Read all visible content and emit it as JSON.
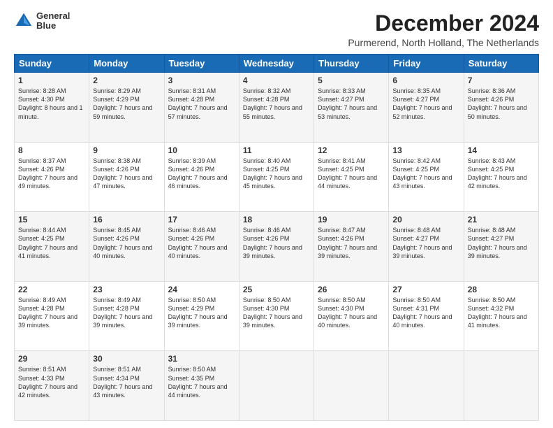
{
  "logo": {
    "line1": "General",
    "line2": "Blue"
  },
  "title": "December 2024",
  "subtitle": "Purmerend, North Holland, The Netherlands",
  "headers": [
    "Sunday",
    "Monday",
    "Tuesday",
    "Wednesday",
    "Thursday",
    "Friday",
    "Saturday"
  ],
  "weeks": [
    [
      {
        "day": "1",
        "sunrise": "Sunrise: 8:28 AM",
        "sunset": "Sunset: 4:30 PM",
        "daylight": "Daylight: 8 hours and 1 minute."
      },
      {
        "day": "2",
        "sunrise": "Sunrise: 8:29 AM",
        "sunset": "Sunset: 4:29 PM",
        "daylight": "Daylight: 7 hours and 59 minutes."
      },
      {
        "day": "3",
        "sunrise": "Sunrise: 8:31 AM",
        "sunset": "Sunset: 4:28 PM",
        "daylight": "Daylight: 7 hours and 57 minutes."
      },
      {
        "day": "4",
        "sunrise": "Sunrise: 8:32 AM",
        "sunset": "Sunset: 4:28 PM",
        "daylight": "Daylight: 7 hours and 55 minutes."
      },
      {
        "day": "5",
        "sunrise": "Sunrise: 8:33 AM",
        "sunset": "Sunset: 4:27 PM",
        "daylight": "Daylight: 7 hours and 53 minutes."
      },
      {
        "day": "6",
        "sunrise": "Sunrise: 8:35 AM",
        "sunset": "Sunset: 4:27 PM",
        "daylight": "Daylight: 7 hours and 52 minutes."
      },
      {
        "day": "7",
        "sunrise": "Sunrise: 8:36 AM",
        "sunset": "Sunset: 4:26 PM",
        "daylight": "Daylight: 7 hours and 50 minutes."
      }
    ],
    [
      {
        "day": "8",
        "sunrise": "Sunrise: 8:37 AM",
        "sunset": "Sunset: 4:26 PM",
        "daylight": "Daylight: 7 hours and 49 minutes."
      },
      {
        "day": "9",
        "sunrise": "Sunrise: 8:38 AM",
        "sunset": "Sunset: 4:26 PM",
        "daylight": "Daylight: 7 hours and 47 minutes."
      },
      {
        "day": "10",
        "sunrise": "Sunrise: 8:39 AM",
        "sunset": "Sunset: 4:26 PM",
        "daylight": "Daylight: 7 hours and 46 minutes."
      },
      {
        "day": "11",
        "sunrise": "Sunrise: 8:40 AM",
        "sunset": "Sunset: 4:25 PM",
        "daylight": "Daylight: 7 hours and 45 minutes."
      },
      {
        "day": "12",
        "sunrise": "Sunrise: 8:41 AM",
        "sunset": "Sunset: 4:25 PM",
        "daylight": "Daylight: 7 hours and 44 minutes."
      },
      {
        "day": "13",
        "sunrise": "Sunrise: 8:42 AM",
        "sunset": "Sunset: 4:25 PM",
        "daylight": "Daylight: 7 hours and 43 minutes."
      },
      {
        "day": "14",
        "sunrise": "Sunrise: 8:43 AM",
        "sunset": "Sunset: 4:25 PM",
        "daylight": "Daylight: 7 hours and 42 minutes."
      }
    ],
    [
      {
        "day": "15",
        "sunrise": "Sunrise: 8:44 AM",
        "sunset": "Sunset: 4:25 PM",
        "daylight": "Daylight: 7 hours and 41 minutes."
      },
      {
        "day": "16",
        "sunrise": "Sunrise: 8:45 AM",
        "sunset": "Sunset: 4:26 PM",
        "daylight": "Daylight: 7 hours and 40 minutes."
      },
      {
        "day": "17",
        "sunrise": "Sunrise: 8:46 AM",
        "sunset": "Sunset: 4:26 PM",
        "daylight": "Daylight: 7 hours and 40 minutes."
      },
      {
        "day": "18",
        "sunrise": "Sunrise: 8:46 AM",
        "sunset": "Sunset: 4:26 PM",
        "daylight": "Daylight: 7 hours and 39 minutes."
      },
      {
        "day": "19",
        "sunrise": "Sunrise: 8:47 AM",
        "sunset": "Sunset: 4:26 PM",
        "daylight": "Daylight: 7 hours and 39 minutes."
      },
      {
        "day": "20",
        "sunrise": "Sunrise: 8:48 AM",
        "sunset": "Sunset: 4:27 PM",
        "daylight": "Daylight: 7 hours and 39 minutes."
      },
      {
        "day": "21",
        "sunrise": "Sunrise: 8:48 AM",
        "sunset": "Sunset: 4:27 PM",
        "daylight": "Daylight: 7 hours and 39 minutes."
      }
    ],
    [
      {
        "day": "22",
        "sunrise": "Sunrise: 8:49 AM",
        "sunset": "Sunset: 4:28 PM",
        "daylight": "Daylight: 7 hours and 39 minutes."
      },
      {
        "day": "23",
        "sunrise": "Sunrise: 8:49 AM",
        "sunset": "Sunset: 4:28 PM",
        "daylight": "Daylight: 7 hours and 39 minutes."
      },
      {
        "day": "24",
        "sunrise": "Sunrise: 8:50 AM",
        "sunset": "Sunset: 4:29 PM",
        "daylight": "Daylight: 7 hours and 39 minutes."
      },
      {
        "day": "25",
        "sunrise": "Sunrise: 8:50 AM",
        "sunset": "Sunset: 4:30 PM",
        "daylight": "Daylight: 7 hours and 39 minutes."
      },
      {
        "day": "26",
        "sunrise": "Sunrise: 8:50 AM",
        "sunset": "Sunset: 4:30 PM",
        "daylight": "Daylight: 7 hours and 40 minutes."
      },
      {
        "day": "27",
        "sunrise": "Sunrise: 8:50 AM",
        "sunset": "Sunset: 4:31 PM",
        "daylight": "Daylight: 7 hours and 40 minutes."
      },
      {
        "day": "28",
        "sunrise": "Sunrise: 8:50 AM",
        "sunset": "Sunset: 4:32 PM",
        "daylight": "Daylight: 7 hours and 41 minutes."
      }
    ],
    [
      {
        "day": "29",
        "sunrise": "Sunrise: 8:51 AM",
        "sunset": "Sunset: 4:33 PM",
        "daylight": "Daylight: 7 hours and 42 minutes."
      },
      {
        "day": "30",
        "sunrise": "Sunrise: 8:51 AM",
        "sunset": "Sunset: 4:34 PM",
        "daylight": "Daylight: 7 hours and 43 minutes."
      },
      {
        "day": "31",
        "sunrise": "Sunrise: 8:50 AM",
        "sunset": "Sunset: 4:35 PM",
        "daylight": "Daylight: 7 hours and 44 minutes."
      },
      null,
      null,
      null,
      null
    ]
  ]
}
